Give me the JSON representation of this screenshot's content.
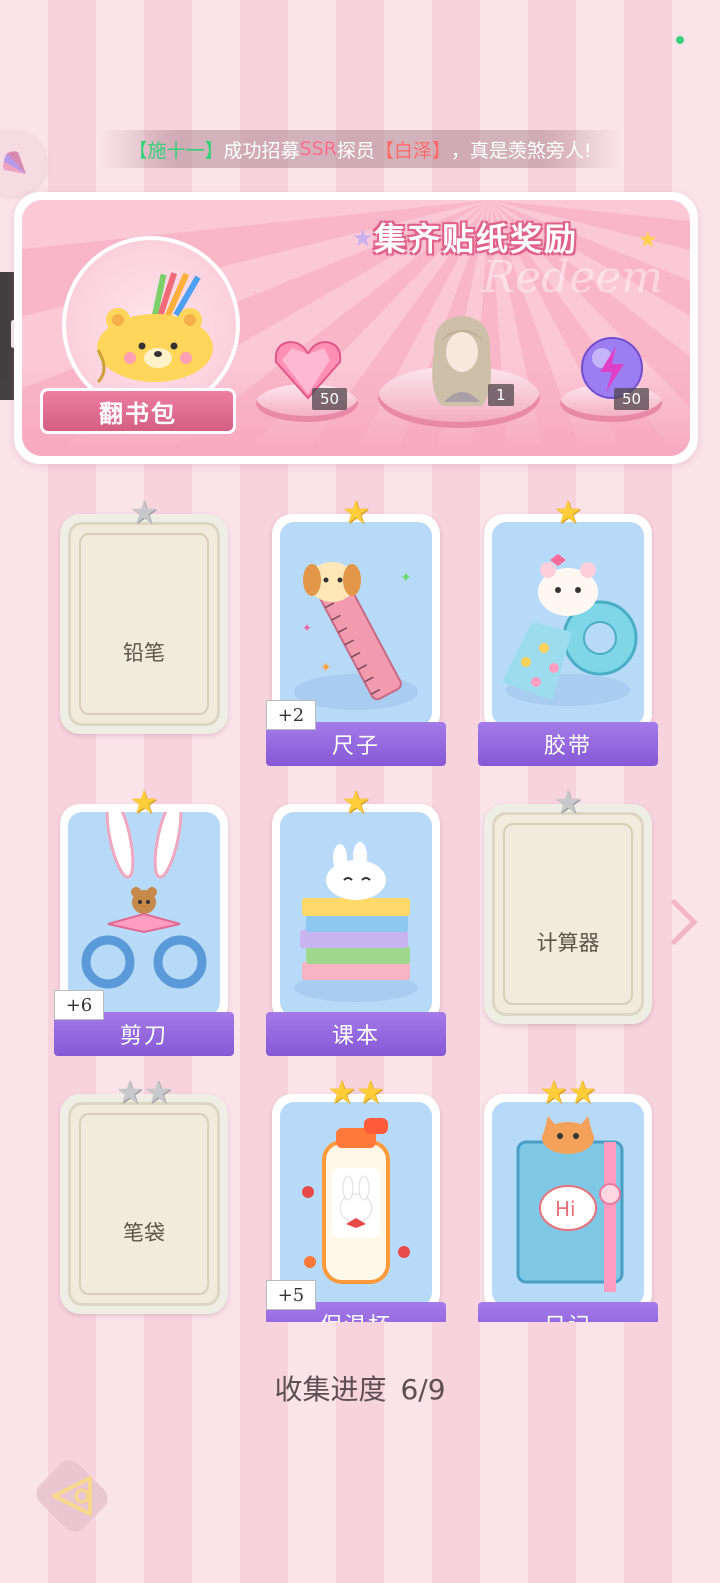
{
  "ticker": {
    "bracket_open_left": "【",
    "player_name": "施十一",
    "bracket_close_left": "】",
    "text_part1": "成功招募",
    "rarity": "SSR",
    "text_part2": "探员",
    "bracket_open_right": "【",
    "agent_name": "白泽",
    "bracket_close_right": "】",
    "text_part3": "，真是羡煞旁人!"
  },
  "banner": {
    "title": "集齐贴纸奖励",
    "bg_word": "Redeem",
    "bag_label": "翻书包",
    "rewards": [
      {
        "icon": "pink-heart-gem-icon",
        "count": "50"
      },
      {
        "icon": "character-portrait-icon",
        "count": "1"
      },
      {
        "icon": "purple-lightning-orb-icon",
        "count": "50"
      }
    ]
  },
  "cards": [
    {
      "name": "铅笔",
      "stars": 1,
      "unlocked": false,
      "bonus": ""
    },
    {
      "name": "尺子",
      "stars": 1,
      "unlocked": true,
      "bonus": "+2",
      "art": "ruler-puppy"
    },
    {
      "name": "胶带",
      "stars": 1,
      "unlocked": true,
      "bonus": "",
      "art": "tape-hamster"
    },
    {
      "name": "剪刀",
      "stars": 1,
      "unlocked": true,
      "bonus": "+6",
      "art": "scissors-bunny"
    },
    {
      "name": "课本",
      "stars": 1,
      "unlocked": true,
      "bonus": "",
      "art": "books-bunny"
    },
    {
      "name": "计算器",
      "stars": 1,
      "unlocked": false,
      "bonus": ""
    },
    {
      "name": "笔袋",
      "stars": 2,
      "unlocked": false,
      "bonus": ""
    },
    {
      "name": "保温杯",
      "stars": 2,
      "unlocked": true,
      "bonus": "+5",
      "art": "thermos-bunny"
    },
    {
      "name": "日记",
      "stars": 2,
      "unlocked": true,
      "bonus": "",
      "art": "diary-cat"
    }
  ],
  "progress": {
    "label": "收集进度",
    "value": "6/9"
  },
  "colors": {
    "ribbon": "#8f62dc",
    "gold_star": "#ffcd3a",
    "grey_star": "#c7c7cc",
    "banner_pink": "#f9b6c8"
  }
}
